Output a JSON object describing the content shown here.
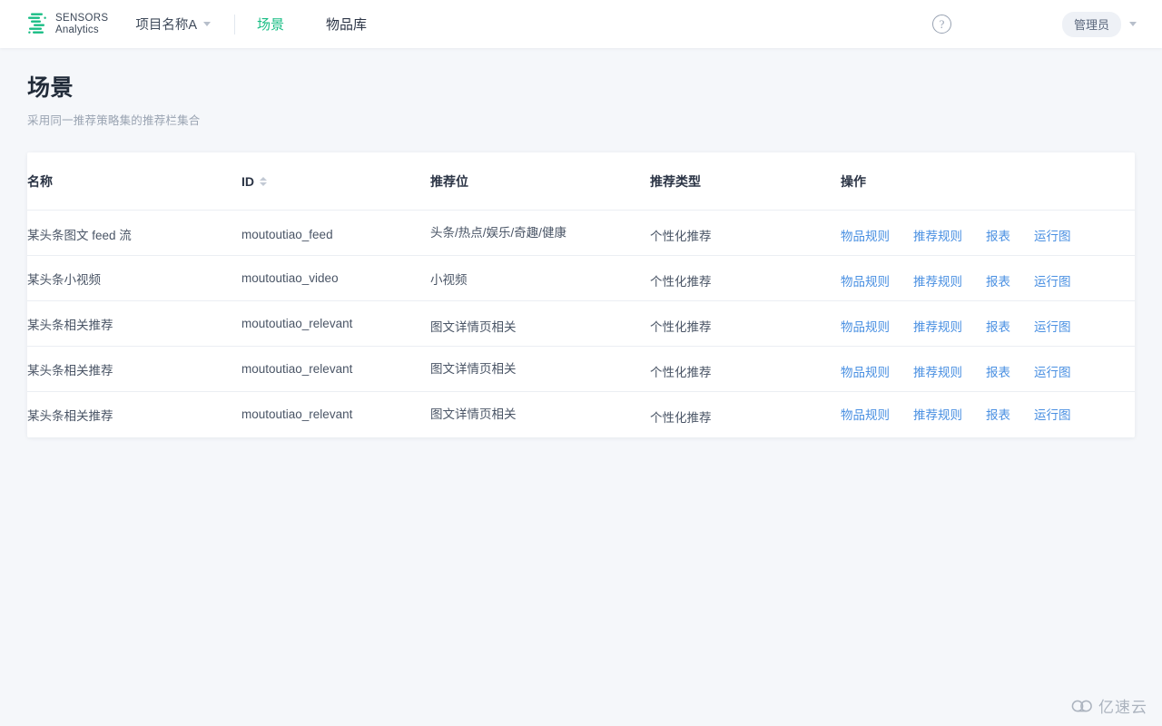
{
  "header": {
    "logo": {
      "icon": "sensors-logo-icon",
      "line1": "SENSORS",
      "line2": "Analytics"
    },
    "project_selector": {
      "label": "项目名称A",
      "chevron": "chevron-down-icon"
    },
    "tabs": [
      {
        "label": "场景",
        "active": true
      },
      {
        "label": "物品库",
        "active": false
      }
    ],
    "help": {
      "icon": "question-mark-icon",
      "glyph": "?"
    },
    "user": {
      "label": "管理员",
      "chevron": "chevron-down-icon"
    }
  },
  "page": {
    "title": "场景",
    "subtitle": "采用同一推荐策略集的推荐栏集合"
  },
  "table": {
    "columns": [
      {
        "key": "name",
        "label": "名称",
        "sortable": false
      },
      {
        "key": "id",
        "label": "ID",
        "sortable": true
      },
      {
        "key": "slot",
        "label": "推荐位",
        "sortable": false
      },
      {
        "key": "type",
        "label": "推荐类型",
        "sortable": false
      },
      {
        "key": "ops",
        "label": "操作",
        "sortable": false
      }
    ],
    "actions": [
      "物品规则",
      "推荐规则",
      "报表",
      "运行图"
    ],
    "rows": [
      {
        "name": "某头条图文 feed 流",
        "id": "moutoutiao_feed",
        "slot": "头条/热点/娱乐/奇趣/健康",
        "type": "个性化推荐"
      },
      {
        "name": "某头条小视频",
        "id": "moutoutiao_video",
        "slot": "小视频",
        "type": "个性化推荐"
      },
      {
        "name": "某头条相关推荐",
        "id": "moutoutiao_relevant",
        "slot": "图文详情页相关",
        "type": "个性化推荐"
      },
      {
        "name": "某头条相关推荐",
        "id": "moutoutiao_relevant",
        "slot": "图文详情页相关",
        "type": "个性化推荐"
      },
      {
        "name": "某头条相关推荐",
        "id": "moutoutiao_relevant",
        "slot": "图文详情页相关",
        "type": "个性化推荐"
      }
    ]
  },
  "watermark": {
    "icon": "cloud-icon",
    "text": "亿速云"
  },
  "colors": {
    "accent_green": "#18bd84",
    "link_blue": "#4a90e2",
    "page_bg": "#f5f7fa",
    "text_dark": "#2b3445",
    "text_muted": "#9aa4b2"
  }
}
